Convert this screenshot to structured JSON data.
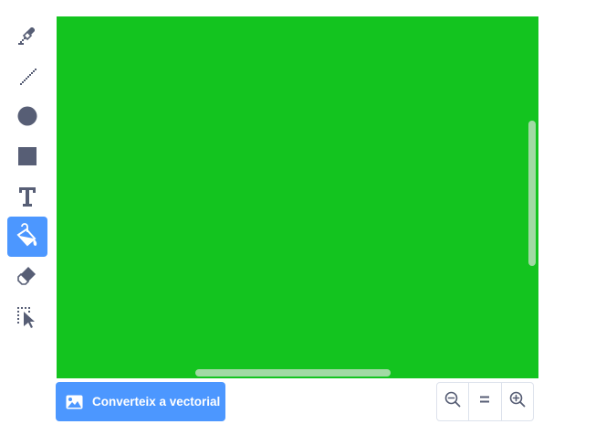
{
  "toolbar": {
    "tools": [
      {
        "name": "brush",
        "icon": "brush-icon",
        "selected": false
      },
      {
        "name": "line",
        "icon": "line-icon",
        "selected": false
      },
      {
        "name": "circle",
        "icon": "circle-icon",
        "selected": false
      },
      {
        "name": "rectangle",
        "icon": "rectangle-icon",
        "selected": false
      },
      {
        "name": "text",
        "icon": "text-icon",
        "selected": false
      },
      {
        "name": "fill",
        "icon": "fill-icon",
        "selected": true
      },
      {
        "name": "eraser",
        "icon": "eraser-icon",
        "selected": false
      },
      {
        "name": "select",
        "icon": "select-icon",
        "selected": false
      }
    ]
  },
  "canvas": {
    "fill_color": "#13c41f"
  },
  "convert": {
    "label": "Converteix a vectorial",
    "icon": "image-icon"
  },
  "zoom": {
    "zoom_out_icon": "zoom-out-icon",
    "reset_icon": "zoom-reset-icon",
    "zoom_in_icon": "zoom-in-icon"
  },
  "colors": {
    "accent": "#4c97ff",
    "icon": "#575e75",
    "canvas": "#13c41f"
  }
}
